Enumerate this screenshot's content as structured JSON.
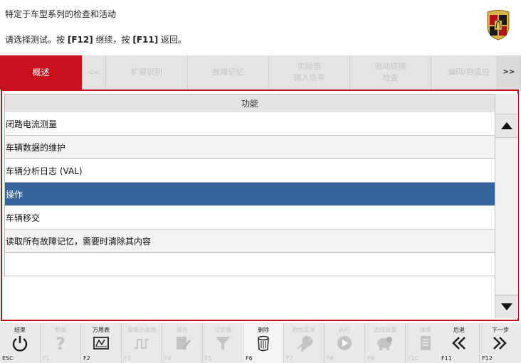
{
  "header": {
    "subtitle": "特定于车型系列的检查和活动",
    "instruction_prefix": "请选择测试。按 ",
    "instruction_key1": "[F12]",
    "instruction_mid": " 继续，按 ",
    "instruction_key2": "[F11]",
    "instruction_suffix": " 返回。"
  },
  "tabs": [
    {
      "label": "概述",
      "active": true
    },
    {
      "label": "<<",
      "active": false
    },
    {
      "label": "扩展识别",
      "active": false
    },
    {
      "label": "故障记忆",
      "active": false
    },
    {
      "label": "实际值\n输入信号",
      "active": false
    },
    {
      "label": "驱动链接\n检查",
      "active": false
    },
    {
      "label": "编码/自适应",
      "active": false
    },
    {
      "label": ">>",
      "active": false
    }
  ],
  "list": {
    "column_header": "功能",
    "rows": [
      {
        "label": "闭路电流测量",
        "selected": false
      },
      {
        "label": "车辆数据的维护",
        "selected": false
      },
      {
        "label": "车辆分析日志 (VAL)",
        "selected": false
      },
      {
        "label": "操作",
        "selected": true
      },
      {
        "label": "车辆移交",
        "selected": false
      },
      {
        "label": "读取所有故障记忆，需要时清除其内容",
        "selected": false
      },
      {
        "label": "",
        "selected": false
      }
    ]
  },
  "toolbar": [
    {
      "label": "结束",
      "key": "ESC",
      "icon": "power-icon",
      "enabled": true
    },
    {
      "label": "帮助",
      "key": "F1",
      "icon": "help-icon",
      "enabled": false
    },
    {
      "label": "万用表",
      "key": "F2",
      "icon": "multimeter-icon",
      "enabled": true
    },
    {
      "label": "测量示波器",
      "key": "F3",
      "icon": "oscilloscope-icon",
      "enabled": false
    },
    {
      "label": "报告",
      "key": "F4",
      "icon": "report-icon",
      "enabled": false
    },
    {
      "label": "过滤器",
      "key": "F5",
      "icon": "filter-icon",
      "enabled": false
    },
    {
      "label": "删除",
      "key": "F6",
      "icon": "trash-icon",
      "enabled": true
    },
    {
      "label": "附加菜单",
      "key": "F7",
      "icon": "tools-icon",
      "enabled": false
    },
    {
      "label": "执行",
      "key": "F8",
      "icon": "play-icon",
      "enabled": false
    },
    {
      "label": "选择装置",
      "key": "F9",
      "icon": "select-device-icon",
      "enabled": false
    },
    {
      "label": "清单",
      "key": "F10",
      "icon": "list-icon",
      "enabled": false
    },
    {
      "label": "后退",
      "key": "F11",
      "icon": "back-icon",
      "enabled": true
    },
    {
      "label": "下一步",
      "key": "F12",
      "icon": "next-icon",
      "enabled": true
    }
  ],
  "colors": {
    "accent_red": "#c8101e",
    "selected_blue": "#35659c"
  }
}
